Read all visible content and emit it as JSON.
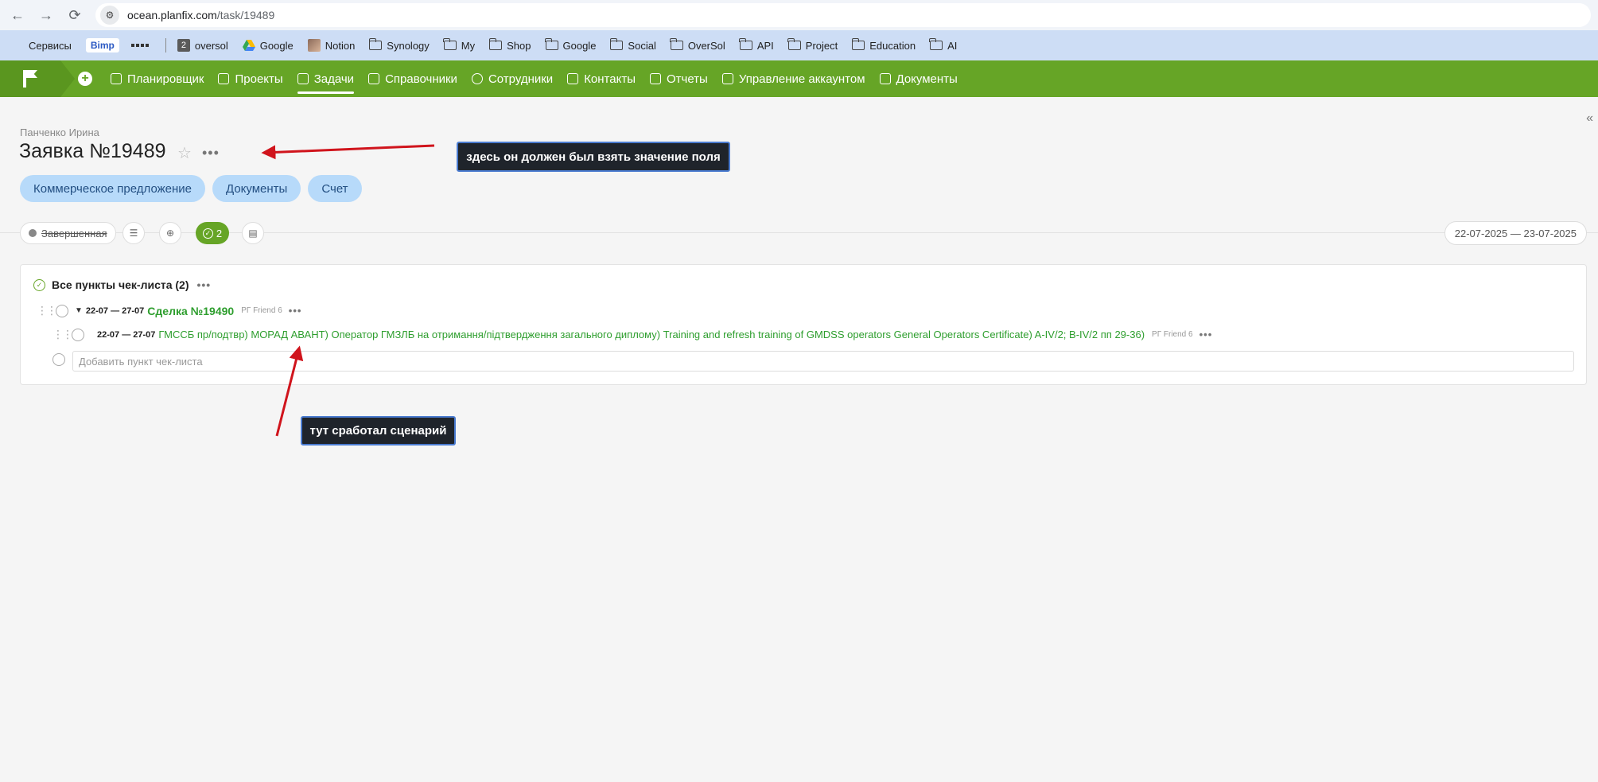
{
  "browser": {
    "url_host": "ocean.planfix.com",
    "url_path": "/task/19489",
    "bookmarks": [
      {
        "label": "Сервисы",
        "icon": "apps-grid-icon"
      },
      {
        "label": "Bimp",
        "icon": "bimp-badge"
      },
      {
        "label": "",
        "icon": "qr-icon"
      },
      {
        "label": "oversol",
        "icon": "number-2-icon",
        "badge": "2"
      },
      {
        "label": "Google",
        "icon": "google-drive-icon"
      },
      {
        "label": "Notion",
        "icon": "notion-avatar-icon"
      },
      {
        "label": "Synology",
        "icon": "folder-icon"
      },
      {
        "label": "My",
        "icon": "folder-icon"
      },
      {
        "label": "Shop",
        "icon": "folder-icon"
      },
      {
        "label": "Google",
        "icon": "folder-icon"
      },
      {
        "label": "Social",
        "icon": "folder-icon"
      },
      {
        "label": "OverSol",
        "icon": "folder-icon"
      },
      {
        "label": "API",
        "icon": "folder-icon"
      },
      {
        "label": "Project",
        "icon": "folder-icon"
      },
      {
        "label": "Education",
        "icon": "folder-icon"
      },
      {
        "label": "AI",
        "icon": "folder-icon"
      }
    ]
  },
  "nav": {
    "items": [
      {
        "label": "Планировщик",
        "icon": "planner-icon"
      },
      {
        "label": "Проекты",
        "icon": "projects-icon"
      },
      {
        "label": "Задачи",
        "icon": "tasks-icon",
        "active": true
      },
      {
        "label": "Справочники",
        "icon": "directories-icon"
      },
      {
        "label": "Сотрудники",
        "icon": "employees-icon"
      },
      {
        "label": "Контакты",
        "icon": "contacts-icon"
      },
      {
        "label": "Отчеты",
        "icon": "reports-icon"
      },
      {
        "label": "Управление аккаунтом",
        "icon": "account-icon"
      },
      {
        "label": "Документы",
        "icon": "documents-icon"
      }
    ],
    "accent": "#66a526"
  },
  "task": {
    "author": "Панченко Ирина",
    "title": "Заявка №19489",
    "tabs": [
      "Коммерческое предложение",
      "Документы",
      "Счет"
    ],
    "status": "Завершенная",
    "checklist_count": "2",
    "date_range": "22-07-2025 — 23-07-2025"
  },
  "checklist": {
    "header": "Все пункты чек-листа (2)",
    "item1": {
      "dates": "22-07 — 27-07",
      "title": "Сделка №19490",
      "assignee": "РГ Friend 6"
    },
    "item2": {
      "dates": "22-07 — 27-07",
      "title": "ГМССБ пр/подтвр) МОРАД АВАНТ) Оператор ГМЗЛБ на отримання/підтвердження загального диплому) Training and refresh training of GMDSS operators General Operators Certificate) A-IV/2; B-IV/2 пп 29-36)",
      "assignee": "РГ Friend 6"
    },
    "add_placeholder": "Добавить пункт чек-листа"
  },
  "annotations": {
    "callout_top": "здесь он должен был взять значение поля",
    "callout_bottom": "тут сработал сценарий",
    "arrow_color": "#d0141c"
  }
}
